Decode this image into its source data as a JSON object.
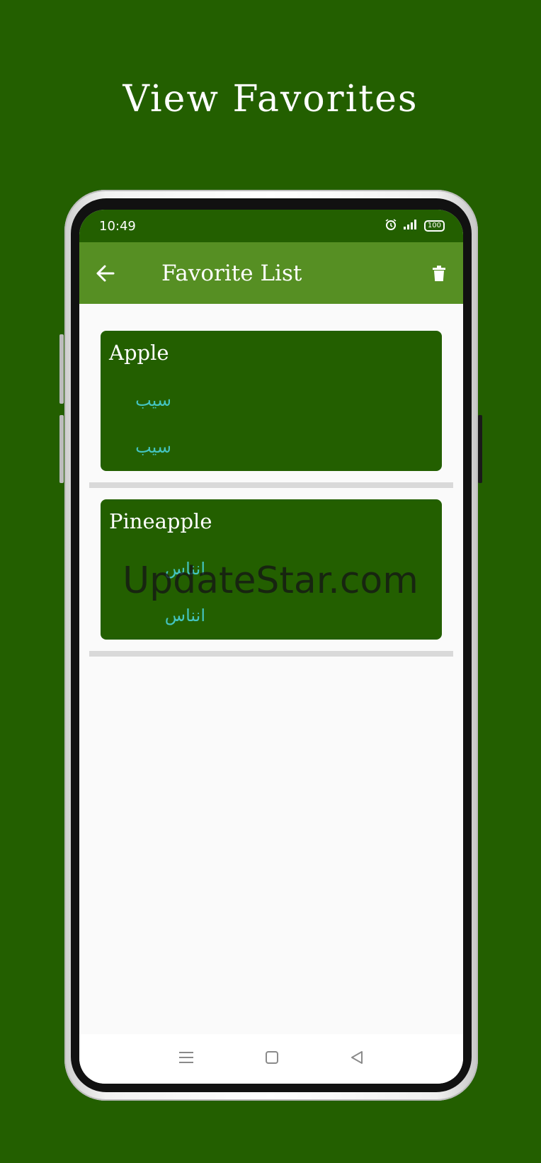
{
  "promo": {
    "title": "View Favorites"
  },
  "status": {
    "time": "10:49",
    "battery": "100"
  },
  "appbar": {
    "title": "Favorite List"
  },
  "favorites": [
    {
      "word": "Apple",
      "translation_1": "سیب",
      "translation_2": "سیب"
    },
    {
      "word": "Pineapple",
      "translation_1": "انناس",
      "translation_2": "انناس"
    }
  ],
  "watermark": "UpdateStar.com",
  "colors": {
    "background": "#235f00",
    "appbar": "#568f23",
    "card": "#235f00",
    "translation": "#44c4c0"
  },
  "icons": [
    "back-arrow-icon",
    "trash-icon",
    "alarm-icon",
    "signal-icon",
    "battery-icon",
    "menu-icon",
    "home-square-icon",
    "back-triangle-icon"
  ]
}
